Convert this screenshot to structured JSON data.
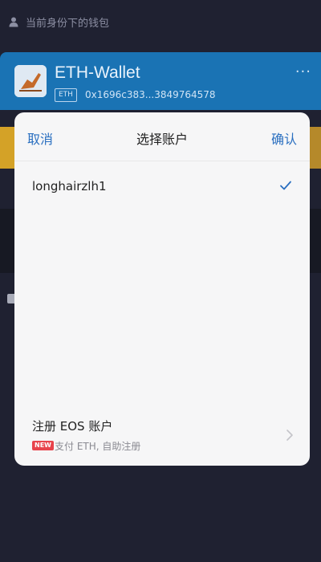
{
  "header": {
    "title": "当前身份下的钱包"
  },
  "wallet": {
    "name": "ETH-Wallet",
    "tag": "ETH",
    "address": "0x1696c383...3849764578",
    "more": "···"
  },
  "modal": {
    "cancel": "取消",
    "title": "选择账户",
    "confirm": "确认",
    "accounts": [
      {
        "name": "longhairzlh1",
        "selected": true
      }
    ],
    "register": {
      "title": "注册 EOS 账户",
      "badge": "NEW",
      "subtitle": "支付 ETH, 自助注册"
    }
  },
  "colors": {
    "accent": "#2a6fc0",
    "wallet_card": "#1a73b4",
    "badge": "#e8434b",
    "background": "#1f2131"
  }
}
